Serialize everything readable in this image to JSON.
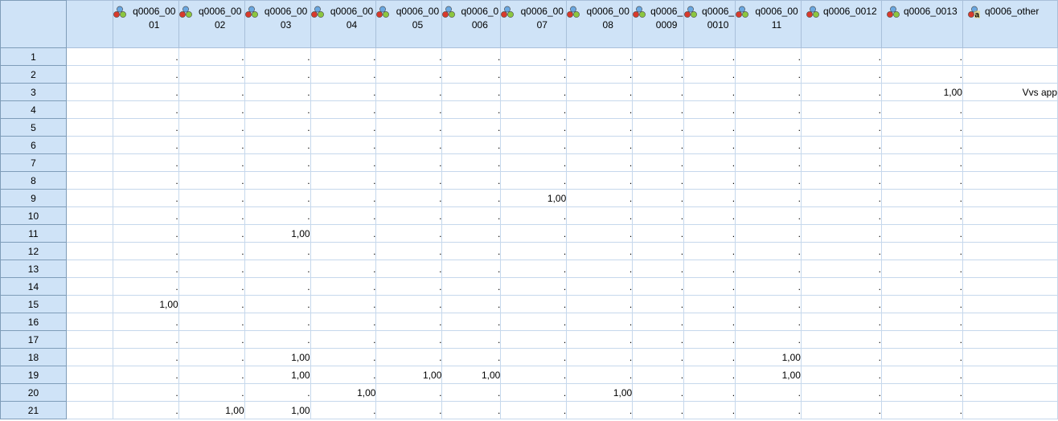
{
  "columns": [
    {
      "label": "",
      "icon": "none",
      "type": "blank"
    },
    {
      "label": "q0006_0001",
      "icon": "nominal-variable-icon",
      "type": "num"
    },
    {
      "label": "q0006_0002",
      "icon": "nominal-variable-icon",
      "type": "num"
    },
    {
      "label": "q0006_0003",
      "icon": "nominal-variable-icon",
      "type": "num"
    },
    {
      "label": "q0006_0004",
      "icon": "nominal-variable-icon",
      "type": "num"
    },
    {
      "label": "q0006_0005",
      "icon": "nominal-variable-icon",
      "type": "num"
    },
    {
      "label": "q0006_0006",
      "icon": "nominal-variable-icon",
      "type": "num"
    },
    {
      "label": "q0006_0007",
      "icon": "nominal-variable-icon",
      "type": "num"
    },
    {
      "label": "q0006_0008",
      "icon": "nominal-variable-icon",
      "type": "num"
    },
    {
      "label": "q0006_0009",
      "icon": "nominal-variable-icon",
      "type": "num"
    },
    {
      "label": "q0006_0010",
      "icon": "nominal-variable-icon",
      "type": "num"
    },
    {
      "label": "q0006_0011",
      "icon": "nominal-variable-icon",
      "type": "num"
    },
    {
      "label": "q0006_0012",
      "icon": "nominal-variable-icon",
      "type": "num"
    },
    {
      "label": "q0006_0013",
      "icon": "nominal-variable-icon",
      "type": "num"
    },
    {
      "label": "q0006_other",
      "icon": "nominal-string-variable-icon",
      "type": "str"
    }
  ],
  "rows": [
    {
      "n": "1",
      "cells": [
        "",
        ".",
        ".",
        ".",
        ".",
        ".",
        ".",
        ".",
        ".",
        ".",
        ".",
        ".",
        ".",
        ".",
        ""
      ]
    },
    {
      "n": "2",
      "cells": [
        "",
        ".",
        ".",
        ".",
        ".",
        ".",
        ".",
        ".",
        ".",
        ".",
        ".",
        ".",
        ".",
        ".",
        ""
      ]
    },
    {
      "n": "3",
      "cells": [
        "",
        ".",
        ".",
        ".",
        ".",
        ".",
        ".",
        ".",
        ".",
        ".",
        ".",
        ".",
        ".",
        "1,00",
        "Vvs app"
      ]
    },
    {
      "n": "4",
      "cells": [
        "",
        ".",
        ".",
        ".",
        ".",
        ".",
        ".",
        ".",
        ".",
        ".",
        ".",
        ".",
        ".",
        ".",
        ""
      ]
    },
    {
      "n": "5",
      "cells": [
        "",
        ".",
        ".",
        ".",
        ".",
        ".",
        ".",
        ".",
        ".",
        ".",
        ".",
        ".",
        ".",
        ".",
        ""
      ]
    },
    {
      "n": "6",
      "cells": [
        "",
        ".",
        ".",
        ".",
        ".",
        ".",
        ".",
        ".",
        ".",
        ".",
        ".",
        ".",
        ".",
        ".",
        ""
      ]
    },
    {
      "n": "7",
      "cells": [
        "",
        ".",
        ".",
        ".",
        ".",
        ".",
        ".",
        ".",
        ".",
        ".",
        ".",
        ".",
        ".",
        ".",
        ""
      ]
    },
    {
      "n": "8",
      "cells": [
        "",
        ".",
        ".",
        ".",
        ".",
        ".",
        ".",
        ".",
        ".",
        ".",
        ".",
        ".",
        ".",
        ".",
        ""
      ]
    },
    {
      "n": "9",
      "cells": [
        "",
        ".",
        ".",
        ".",
        ".",
        ".",
        ".",
        "1,00",
        ".",
        ".",
        ".",
        ".",
        ".",
        ".",
        ""
      ]
    },
    {
      "n": "10",
      "cells": [
        "",
        ".",
        ".",
        ".",
        ".",
        ".",
        ".",
        ".",
        ".",
        ".",
        ".",
        ".",
        ".",
        ".",
        ""
      ]
    },
    {
      "n": "11",
      "cells": [
        "",
        ".",
        ".",
        "1,00",
        ".",
        ".",
        ".",
        ".",
        ".",
        ".",
        ".",
        ".",
        ".",
        ".",
        ""
      ]
    },
    {
      "n": "12",
      "cells": [
        "",
        ".",
        ".",
        ".",
        ".",
        ".",
        ".",
        ".",
        ".",
        ".",
        ".",
        ".",
        ".",
        ".",
        ""
      ]
    },
    {
      "n": "13",
      "cells": [
        "",
        ".",
        ".",
        ".",
        ".",
        ".",
        ".",
        ".",
        ".",
        ".",
        ".",
        ".",
        ".",
        ".",
        ""
      ]
    },
    {
      "n": "14",
      "cells": [
        "",
        ".",
        ".",
        ".",
        ".",
        ".",
        ".",
        ".",
        ".",
        ".",
        ".",
        ".",
        ".",
        ".",
        ""
      ]
    },
    {
      "n": "15",
      "cells": [
        "",
        "1,00",
        ".",
        ".",
        ".",
        ".",
        ".",
        ".",
        ".",
        ".",
        ".",
        ".",
        ".",
        ".",
        ""
      ]
    },
    {
      "n": "16",
      "cells": [
        "",
        ".",
        ".",
        ".",
        ".",
        ".",
        ".",
        ".",
        ".",
        ".",
        ".",
        ".",
        ".",
        ".",
        ""
      ]
    },
    {
      "n": "17",
      "cells": [
        "",
        ".",
        ".",
        ".",
        ".",
        ".",
        ".",
        ".",
        ".",
        ".",
        ".",
        ".",
        ".",
        ".",
        ""
      ]
    },
    {
      "n": "18",
      "cells": [
        "",
        ".",
        ".",
        "1,00",
        ".",
        ".",
        ".",
        ".",
        ".",
        ".",
        ".",
        "1,00",
        ".",
        ".",
        ""
      ]
    },
    {
      "n": "19",
      "cells": [
        "",
        ".",
        ".",
        "1,00",
        ".",
        "1,00",
        "1,00",
        ".",
        ".",
        ".",
        ".",
        "1,00",
        ".",
        ".",
        ""
      ]
    },
    {
      "n": "20",
      "cells": [
        "",
        ".",
        ".",
        ".",
        "1,00",
        ".",
        ".",
        ".",
        "1,00",
        ".",
        ".",
        ".",
        ".",
        ".",
        ""
      ]
    },
    {
      "n": "21",
      "cells": [
        "",
        ".",
        "1,00",
        "1,00",
        ".",
        ".",
        ".",
        ".",
        ".",
        ".",
        ".",
        ".",
        ".",
        ".",
        ""
      ]
    }
  ]
}
